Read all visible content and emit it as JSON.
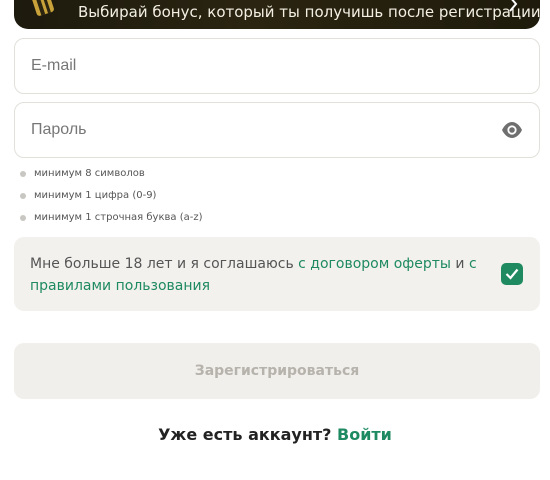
{
  "banner": {
    "text": "Выбирай бонус, который ты получишь после регистрации",
    "gift_icon": "gift-card-icon",
    "chevron_icon": "chevron-right-icon"
  },
  "email": {
    "placeholder": "E-mail",
    "value": ""
  },
  "password": {
    "placeholder": "Пароль",
    "value": "",
    "toggle_icon": "eye-icon"
  },
  "password_rules": [
    "минимум 8 символов",
    "минимум 1 цифра (0-9)",
    "минимум 1 строчная буква (a-z)"
  ],
  "agreement": {
    "text_1": "Мне больше 18 лет и я соглашаюсь ",
    "link_1": "с договором оферты",
    "text_2": " и ",
    "link_2": "с правилами пользования",
    "checked": true
  },
  "register_button": "Зарегистрироваться",
  "login": {
    "prompt": "Уже есть аккаунт? ",
    "link": "Войти"
  },
  "colors": {
    "accent": "#1f8a60",
    "banner_bg": "#231f0f",
    "field_border": "#e2e0db",
    "agree_bg": "#f3f1ee",
    "button_bg": "#f1efeb",
    "button_text": "#b6b2ac"
  }
}
